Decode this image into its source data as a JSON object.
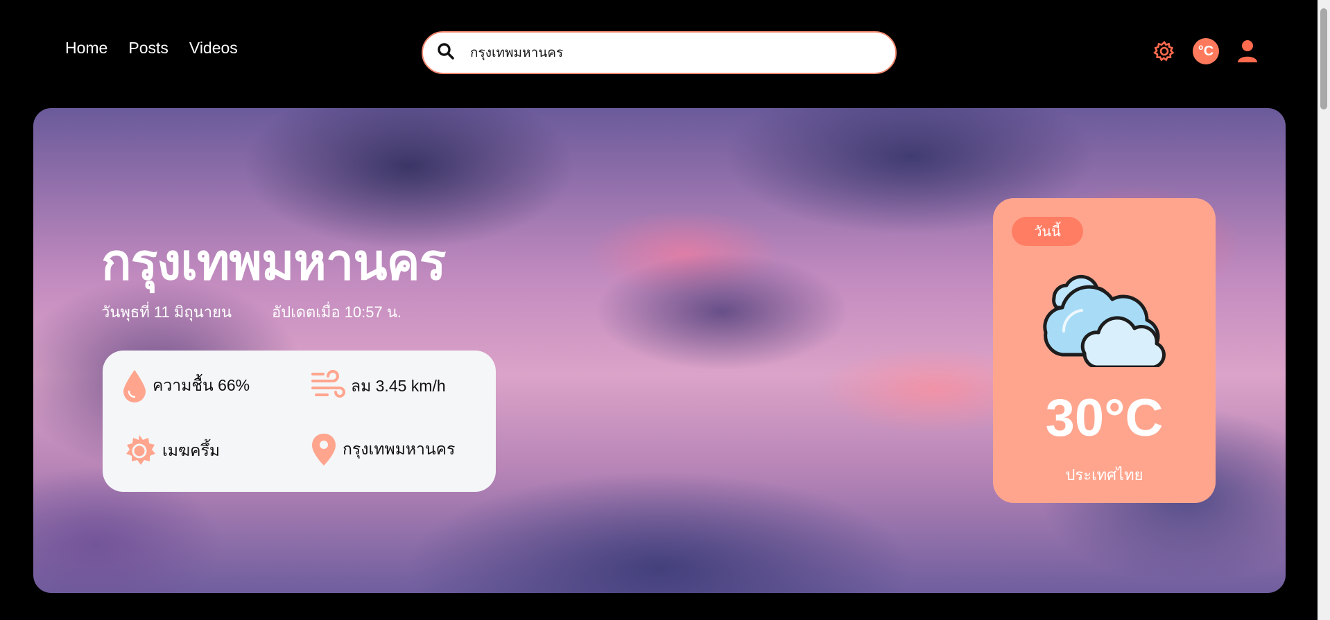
{
  "nav": {
    "items": [
      "Home",
      "Posts",
      "Videos"
    ]
  },
  "search": {
    "value": "กรุงเทพมหานคร"
  },
  "header_icons": {
    "settings": "gear-icon",
    "unit_label": "°C",
    "profile": "user-icon"
  },
  "hero": {
    "city": "กรุงเทพมหานคร",
    "date": "วันพุธที่ 11 มิถุนายน",
    "updated": "อัปเดตเมื่อ 10:57 น."
  },
  "stats": {
    "humidity": "ความชื้น 66%",
    "wind": "ลม 3.45 km/h",
    "condition": "เมฆครึ้ม",
    "location": "กรุงเทพมหานคร"
  },
  "today": {
    "badge": "วันนี้",
    "temp": "30°C",
    "country": "ประเทศไทย",
    "icon": "cloudy-icon"
  },
  "colors": {
    "accent": "#ff7a5c",
    "card": "#ffa58e",
    "badge": "#ff7d63"
  }
}
